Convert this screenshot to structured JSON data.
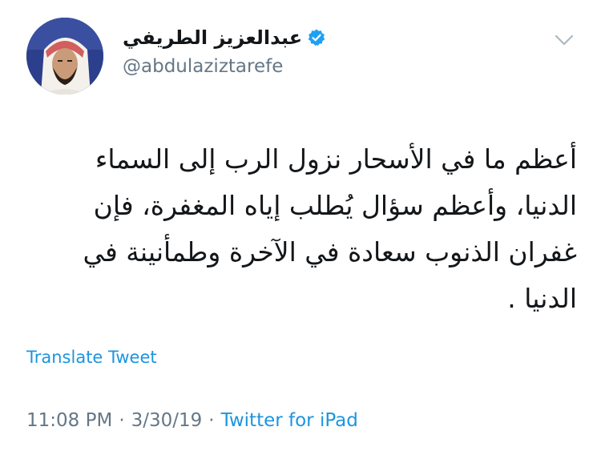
{
  "author": {
    "display_name": "عبدالعزيز الطريفي",
    "handle": "@abdulaziztarefe",
    "verified_icon": "verified-badge-icon",
    "verified_color": "#1da1f2"
  },
  "tweet": {
    "lines": [
      "أعظم ما في الأسحار نزول الرب إلى السماء",
      "الدنيا، وأعظم سؤال يُطلب إياه المغفرة، فإن",
      "غفران الذنوب سعادة في الآخرة وطمأنينة في",
      "الدنيا ."
    ]
  },
  "actions": {
    "translate_label": "Translate Tweet",
    "menu_icon": "chevron-down-icon"
  },
  "meta": {
    "time": "11:08 PM",
    "separator_1": "·",
    "date": "3/30/19",
    "separator_2": "·",
    "source": "Twitter for iPad"
  },
  "colors": {
    "link": "#1b95e0",
    "secondary": "#657786",
    "text": "#14171a"
  }
}
